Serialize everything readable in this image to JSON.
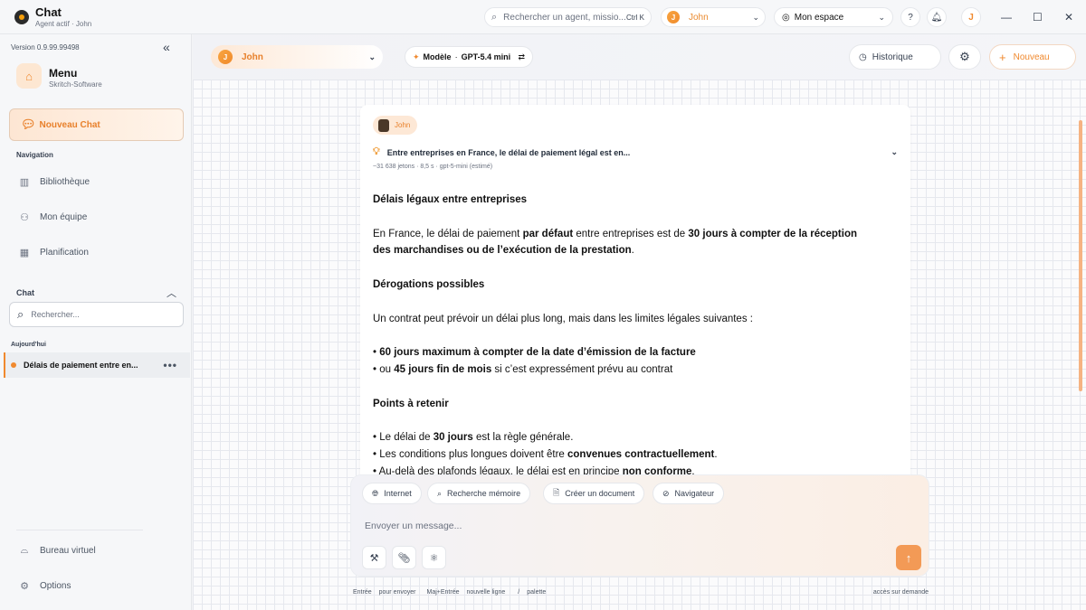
{
  "app": {
    "title": "Chat",
    "subtitle": "Agent actif · John"
  },
  "topbar": {
    "search_placeholder": "Rechercher un agent, missio...",
    "search_shortcut": "Ctrl K",
    "user_initial": "J",
    "user_name": "John",
    "space_label": "Mon espace",
    "avatar_initial": "J"
  },
  "sidebar": {
    "version": "Version 0.9.99.99498",
    "menu_title": "Menu",
    "menu_subtitle": "Skritch-Software",
    "new_chat": "Nouveau Chat",
    "nav_section": "Navigation",
    "nav_items": [
      {
        "label": "Bibliothèque",
        "icon": "library-icon"
      },
      {
        "label": "Mon équipe",
        "icon": "team-icon"
      },
      {
        "label": "Planification",
        "icon": "calendar-icon"
      }
    ],
    "chat_section": "Chat",
    "chat_search_placeholder": "Rechercher...",
    "today_label": "Aujourd'hui",
    "history_item": "Délais de paiement entre en...",
    "bottom_items": [
      {
        "label": "Bureau virtuel",
        "icon": "vr-headset-icon"
      },
      {
        "label": "Options",
        "icon": "gear-icon"
      }
    ]
  },
  "main": {
    "agent_initial": "J",
    "agent_name": "John",
    "model_label": "Modèle",
    "model_sep": "·",
    "model_name": "GPT-5.4 mini",
    "history_button": "Historique",
    "new_button": "Nouveau"
  },
  "message": {
    "author": "John",
    "thinking_title": "Entre entreprises en France, le délai de paiement légal est en...",
    "meta": "~31 638 jetons · 8,5 s · gpt-5-mini (estimé)",
    "h1": "Délais légaux entre entreprises",
    "p1_a": "En France, le délai de paiement ",
    "p1_b": "par défaut",
    "p1_c": " entre entreprises est de ",
    "p1_d": "30 jours à compter de la réception des marchandises ou de l’exécution de la prestation",
    "p1_e": ".",
    "h2": "Dérogations possibles",
    "p2": "Un contrat peut prévoir un délai plus long, mais dans les limites légales suivantes :",
    "b1_a": "• ",
    "b1_b": "60 jours maximum à compter de la date d’émission de la facture",
    "b2_a": "• ou ",
    "b2_b": "45 jours fin de mois",
    "b2_c": " si c’est expressément prévu au contrat",
    "h3": "Points à retenir",
    "c1_a": "• Le délai de ",
    "c1_b": "30 jours",
    "c1_c": " est la règle générale.",
    "c2_a": "• Les conditions plus longues doivent être ",
    "c2_b": "convenues contractuellement",
    "c2_c": ".",
    "c3_a": "• Au-delà des plafonds légaux, le délai est en principe ",
    "c3_b": "non conforme",
    "c3_c": "."
  },
  "composer": {
    "tools": [
      "Internet",
      "Recherche mémoire",
      "Créer un document",
      "Navigateur"
    ],
    "placeholder": "Envoyer un message..."
  },
  "hints": {
    "k1": "Entrée",
    "d1": "pour envoyer",
    "k2": "Maj+Entrée",
    "d2": "nouvelle ligne",
    "k3": "/",
    "d3": "palette",
    "right": "accès sur demande"
  }
}
